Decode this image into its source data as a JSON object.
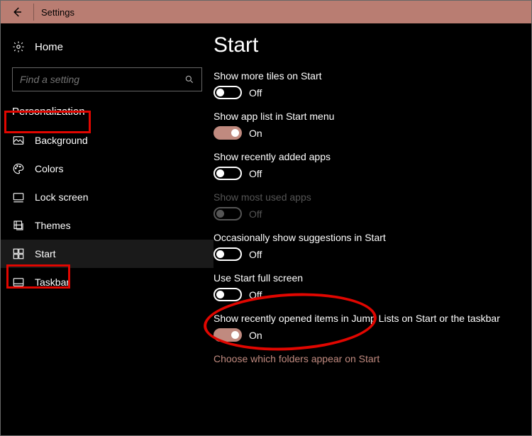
{
  "titlebar": {
    "title": "Settings"
  },
  "sidebar": {
    "home_label": "Home",
    "search_placeholder": "Find a setting",
    "category_label": "Personalization",
    "items": [
      {
        "label": "Background"
      },
      {
        "label": "Colors"
      },
      {
        "label": "Lock screen"
      },
      {
        "label": "Themes"
      },
      {
        "label": "Start"
      },
      {
        "label": "Taskbar"
      }
    ]
  },
  "page": {
    "title": "Start",
    "settings": [
      {
        "label": "Show more tiles on Start",
        "state": "Off",
        "on": false,
        "disabled": false
      },
      {
        "label": "Show app list in Start menu",
        "state": "On",
        "on": true,
        "disabled": false
      },
      {
        "label": "Show recently added apps",
        "state": "Off",
        "on": false,
        "disabled": false
      },
      {
        "label": "Show most used apps",
        "state": "Off",
        "on": false,
        "disabled": true
      },
      {
        "label": "Occasionally show suggestions in Start",
        "state": "Off",
        "on": false,
        "disabled": false
      },
      {
        "label": "Use Start full screen",
        "state": "Off",
        "on": false,
        "disabled": false
      },
      {
        "label": "Show recently opened items in Jump Lists on Start or the taskbar",
        "state": "On",
        "on": true,
        "disabled": false
      }
    ],
    "link": "Choose which folders appear on Start"
  }
}
